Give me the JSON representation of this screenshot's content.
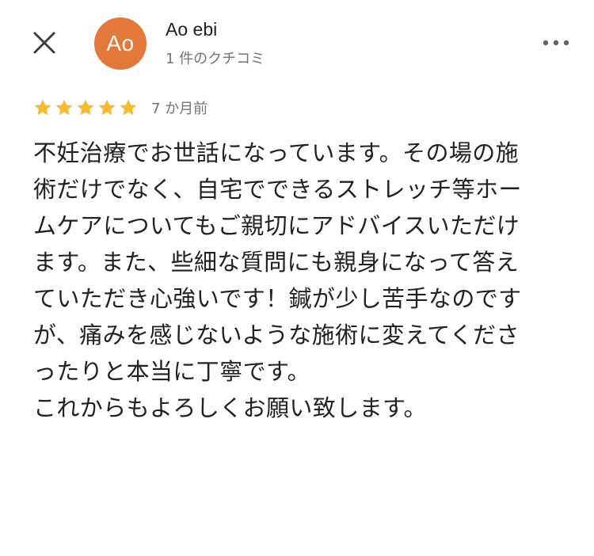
{
  "header": {
    "close_icon": "close-icon",
    "avatar_initials": "Ao",
    "avatar_color": "#e2793a",
    "user_name": "Ao ebi",
    "review_count": "1 件のクチコミ",
    "more_icon": "more-vertical-icon"
  },
  "review": {
    "rating": 5,
    "max_rating": 5,
    "star_color": "#f6bb2e",
    "time_ago": "7 か月前",
    "text": "不妊治療でお世話になっています。その場の施術だけでなく、自宅でできるストレッチ等ホームケアについてもご親切にアドバイスいただけます。また、些細な質問にも親身になって答えていただき心強いです！鍼が少し苦手なのですが、痛みを感じないような施術に変えてくださったりと本当に丁寧です。\nこれからもよろしくお願い致します。"
  }
}
